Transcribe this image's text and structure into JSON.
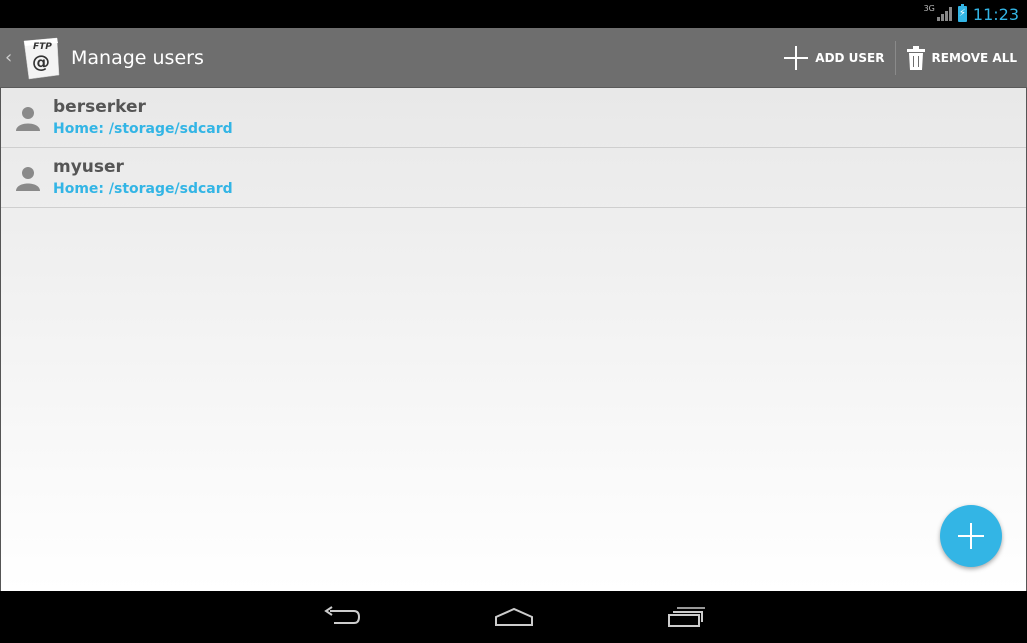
{
  "status_bar": {
    "network": "3G",
    "time": "11:23",
    "accent_color": "#33b5e5"
  },
  "action_bar": {
    "title": "Manage users",
    "app_icon_text": "FTP",
    "app_icon_symbol": "@",
    "add_user_label": "ADD USER",
    "remove_all_label": "REMOVE ALL"
  },
  "users": [
    {
      "name": "berserker",
      "home": "Home: /storage/sdcard"
    },
    {
      "name": "myuser",
      "home": "Home: /storage/sdcard"
    }
  ],
  "icons": {
    "up": "chevron-left-icon",
    "add": "plus-icon",
    "remove": "trash-icon",
    "user": "person-icon",
    "back": "back-arrow-icon",
    "home": "home-icon",
    "recents": "recents-icon"
  }
}
